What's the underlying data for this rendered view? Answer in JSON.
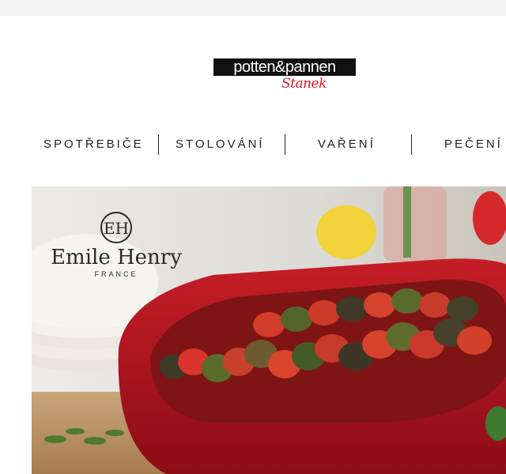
{
  "logo": {
    "wordmark": "potten&pannen",
    "script": "Stanek"
  },
  "nav": {
    "items": [
      {
        "label": "SPOTŘEBIČE"
      },
      {
        "label": "STOLOVÁNÍ"
      },
      {
        "label": "VAŘENÍ"
      },
      {
        "label": "PEČENÍ"
      }
    ]
  },
  "hero": {
    "brand_monogram": "EH",
    "brand_name": "Emile Henry",
    "brand_country": "FRANCE"
  },
  "colors": {
    "accent_red": "#d71920",
    "dish_red": "#b0131d"
  }
}
